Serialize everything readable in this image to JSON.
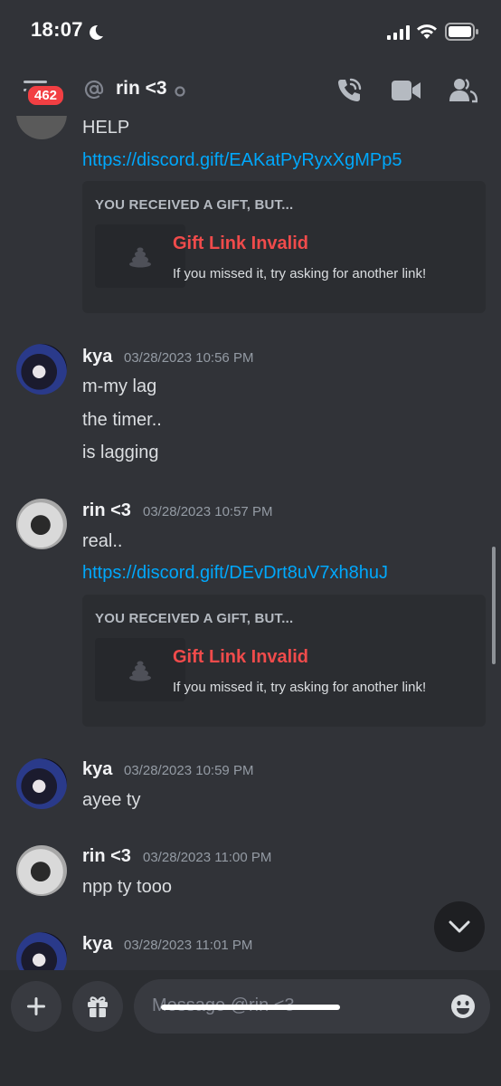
{
  "status_bar": {
    "time": "18:07",
    "icons": [
      "moon-icon",
      "signal-icon",
      "wifi-icon",
      "battery-icon"
    ]
  },
  "header": {
    "unread_badge": "462",
    "channel_name": "rin <3",
    "icons": [
      "menu-icon",
      "at-icon",
      "status-icon",
      "call-icon",
      "video-icon",
      "members-icon"
    ]
  },
  "messages": [
    {
      "text_lines": [
        "HELP"
      ],
      "link": "https://discord.gift/EAKatPyRyxXgMPp5",
      "embed": {
        "title": "YOU RECEIVED A GIFT, BUT...",
        "heading": "Gift Link Invalid",
        "subtext": "If you missed it, try asking for another link!"
      }
    },
    {
      "author": "kya",
      "timestamp": "03/28/2023 10:56 PM",
      "text_lines": [
        "m-my lag",
        "the timer..",
        "is lagging"
      ]
    },
    {
      "author": "rin <3",
      "timestamp": "03/28/2023 10:57 PM",
      "text_lines": [
        "real.."
      ],
      "link": "https://discord.gift/DEvDrt8uV7xh8huJ",
      "embed": {
        "title": "YOU RECEIVED A GIFT, BUT...",
        "heading": "Gift Link Invalid",
        "subtext": "If you missed it, try asking for another link!"
      }
    },
    {
      "author": "kya",
      "timestamp": "03/28/2023 10:59 PM",
      "text_lines": [
        "ayee ty"
      ]
    },
    {
      "author": "rin <3",
      "timestamp": "03/28/2023 11:00 PM",
      "text_lines": [
        "npp ty tooo"
      ]
    },
    {
      "author": "kya",
      "timestamp": "03/28/2023 11:01 PM",
      "text_lines": []
    }
  ],
  "composer": {
    "placeholder": "Message @rin <3",
    "icons": [
      "plus-icon",
      "gift-icon",
      "emoji-icon"
    ]
  },
  "colors": {
    "background": "#313338",
    "composer_bg": "#2b2d31",
    "link": "#00a8fc",
    "invalid_red": "#f04b4b",
    "badge_red": "#f23f43"
  }
}
